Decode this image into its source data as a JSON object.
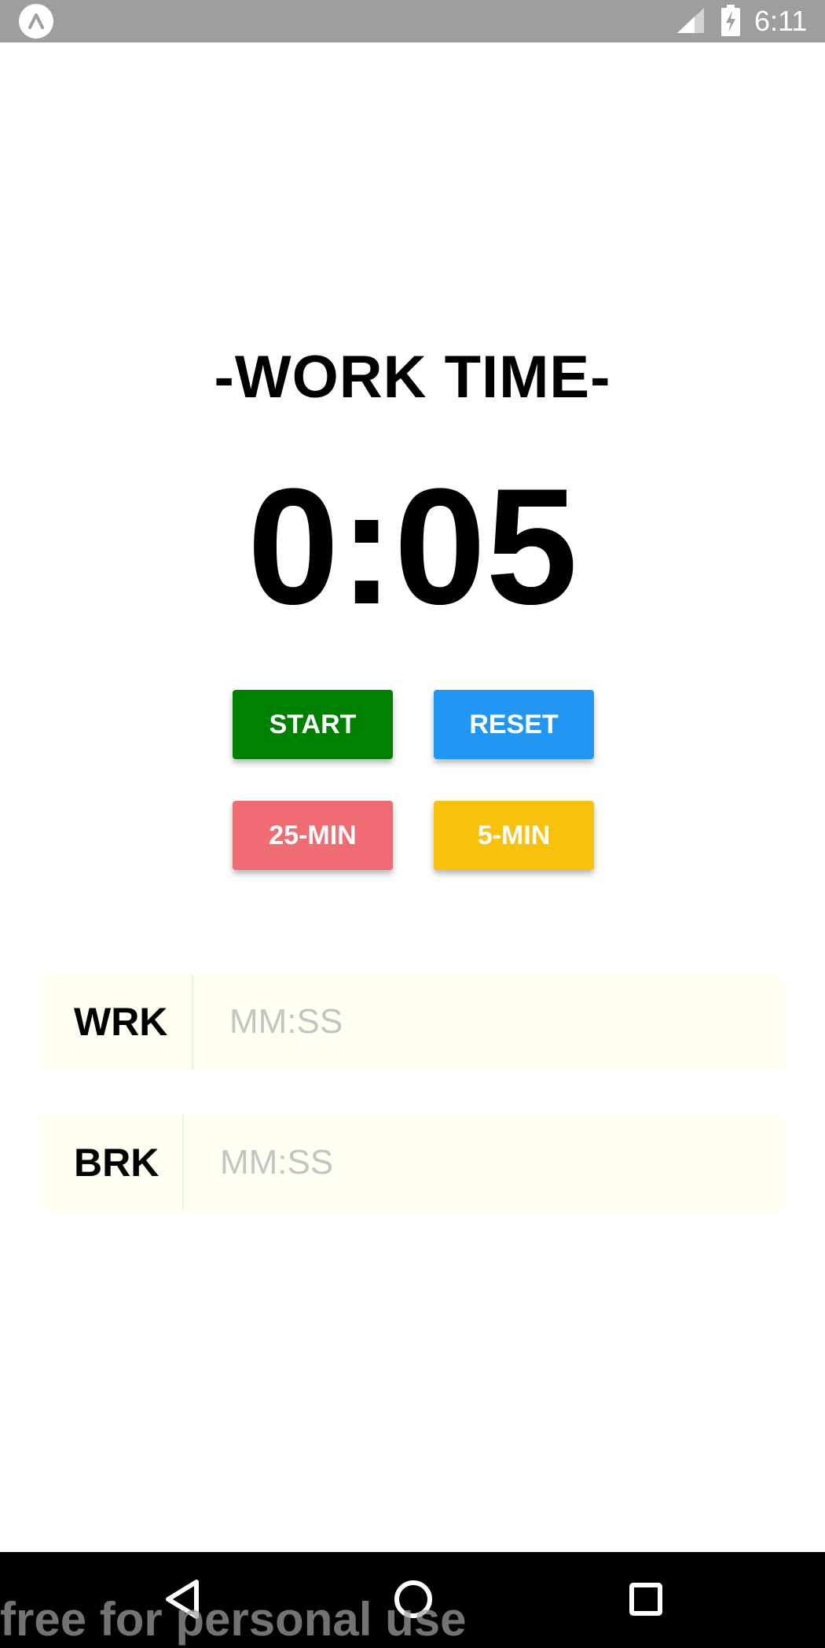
{
  "status_bar": {
    "time": "6:11",
    "icons": [
      "app-badge-icon",
      "signal-icon",
      "battery-charging-icon"
    ]
  },
  "timer": {
    "mode_title": "-WORK TIME-",
    "display": "0:05"
  },
  "buttons": {
    "start": {
      "label": "START",
      "color": "#008000"
    },
    "reset": {
      "label": "RESET",
      "color": "#2196F3"
    },
    "preset_25": {
      "label": "25-MIN",
      "color": "#F06C73"
    },
    "preset_5": {
      "label": "5-MIN",
      "color": "#F8C10C"
    }
  },
  "inputs": {
    "work": {
      "label": "WRK",
      "value": "",
      "placeholder": "MM:SS"
    },
    "break": {
      "label": "BRK",
      "value": "",
      "placeholder": "MM:SS"
    }
  },
  "nav_bar": {
    "icons": [
      "back-icon",
      "home-icon",
      "recents-icon"
    ]
  },
  "watermark": "free for personal use"
}
